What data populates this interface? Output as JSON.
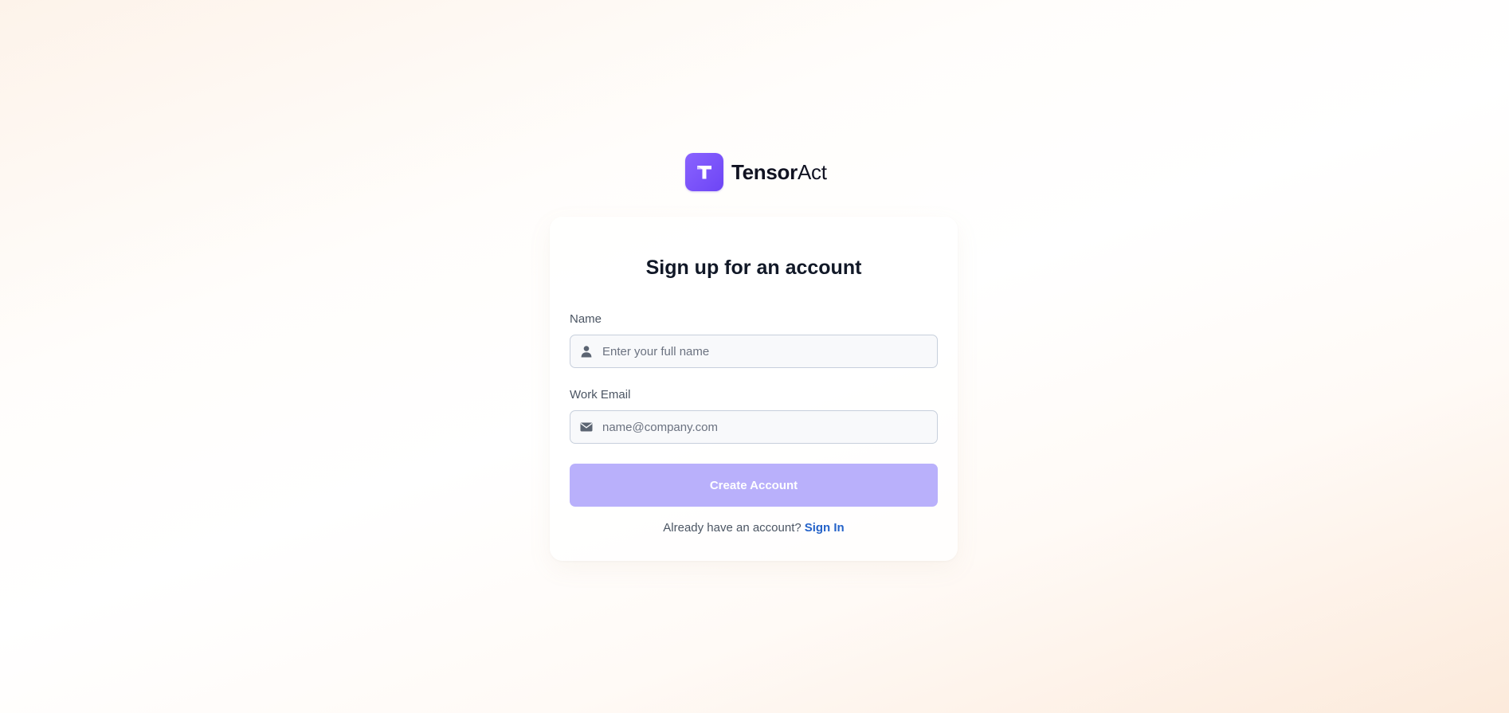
{
  "brand": {
    "name_strong": "Tensor",
    "name_light": "Act",
    "logo_icon": "tensoract-logo-icon",
    "accent_color": "#7c55f8"
  },
  "signup": {
    "title": "Sign up for an account",
    "name_field": {
      "label": "Name",
      "placeholder": "Enter your full name",
      "value": "",
      "icon": "user-icon"
    },
    "email_field": {
      "label": "Work Email",
      "placeholder": "name@company.com",
      "value": "",
      "icon": "mail-icon"
    },
    "submit_label": "Create Account",
    "submit_color": "#b9b0fb",
    "signin_prompt": "Already have an account?",
    "signin_link": "Sign In",
    "link_color": "#2563c9"
  }
}
